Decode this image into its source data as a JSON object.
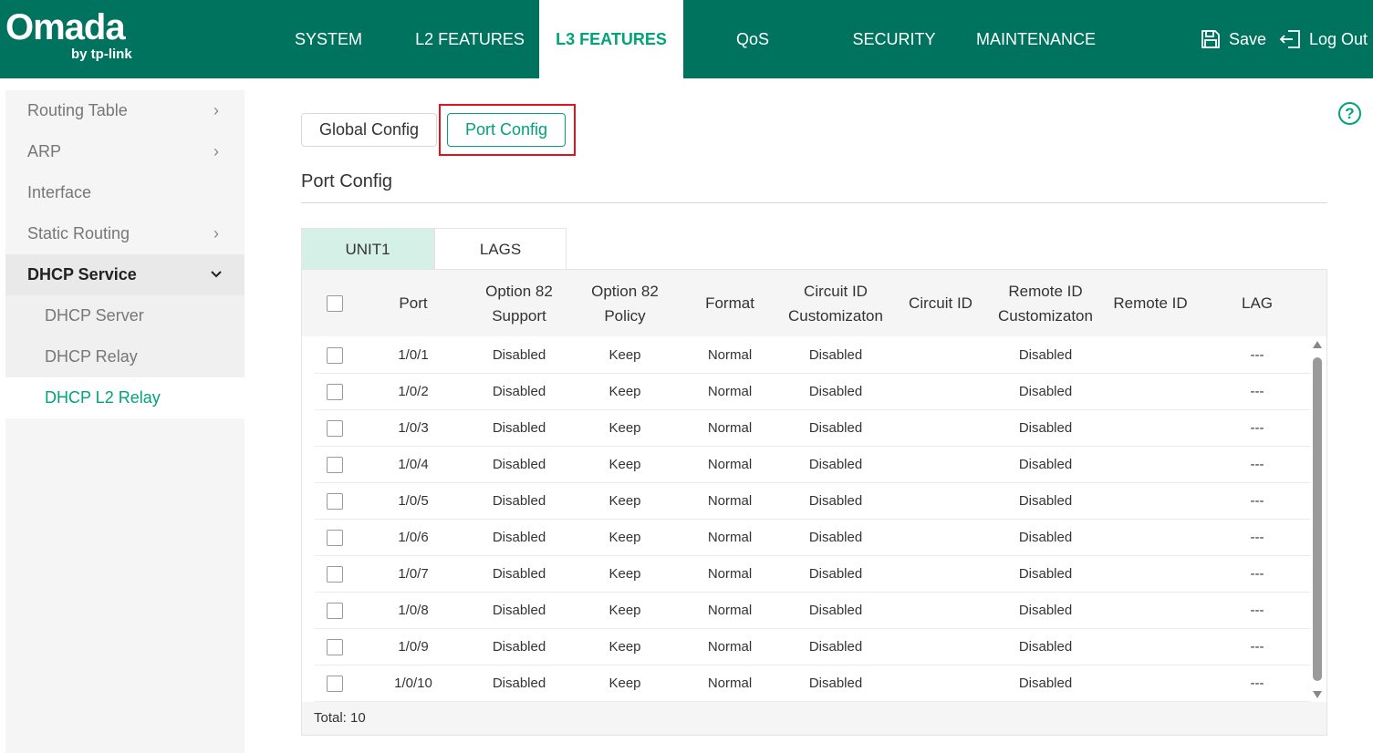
{
  "brand": {
    "name": "Omada",
    "sub": "by tp-link"
  },
  "nav": {
    "items": [
      {
        "label": "SYSTEM"
      },
      {
        "label": "L2 FEATURES"
      },
      {
        "label": "L3 FEATURES"
      },
      {
        "label": "QoS"
      },
      {
        "label": "SECURITY"
      },
      {
        "label": "MAINTENANCE"
      }
    ],
    "active": "L3 FEATURES"
  },
  "actions": {
    "save": "Save",
    "logout": "Log Out"
  },
  "sidebar": {
    "items": [
      {
        "label": "Routing Table",
        "chevron": ">"
      },
      {
        "label": "ARP",
        "chevron": ">"
      },
      {
        "label": "Interface"
      },
      {
        "label": "Static Routing",
        "chevron": ">"
      },
      {
        "label": "DHCP Service",
        "chevron": "v"
      },
      {
        "label": "DHCP Server"
      },
      {
        "label": "DHCP Relay"
      },
      {
        "label": "DHCP L2 Relay"
      }
    ]
  },
  "help": "?",
  "tabs": {
    "global": "Global Config",
    "port": "Port Config"
  },
  "section_title": "Port Config",
  "unit_tabs": {
    "unit1": "UNIT1",
    "lags": "LAGS"
  },
  "table": {
    "headers": {
      "port": "Port",
      "opt82_support_1": "Option 82",
      "opt82_support_2": "Support",
      "opt82_policy_1": "Option 82",
      "opt82_policy_2": "Policy",
      "format": "Format",
      "cid_custom_1": "Circuit ID",
      "cid_custom_2": "Customizaton",
      "cid": "Circuit ID",
      "rid_custom_1": "Remote ID",
      "rid_custom_2": "Customizaton",
      "rid": "Remote ID",
      "lag": "LAG"
    },
    "rows": [
      {
        "port": "1/0/1",
        "support": "Disabled",
        "policy": "Keep",
        "format": "Normal",
        "cid_custom": "Disabled",
        "cid": "",
        "rid_custom": "Disabled",
        "rid": "",
        "lag": "---"
      },
      {
        "port": "1/0/2",
        "support": "Disabled",
        "policy": "Keep",
        "format": "Normal",
        "cid_custom": "Disabled",
        "cid": "",
        "rid_custom": "Disabled",
        "rid": "",
        "lag": "---"
      },
      {
        "port": "1/0/3",
        "support": "Disabled",
        "policy": "Keep",
        "format": "Normal",
        "cid_custom": "Disabled",
        "cid": "",
        "rid_custom": "Disabled",
        "rid": "",
        "lag": "---"
      },
      {
        "port": "1/0/4",
        "support": "Disabled",
        "policy": "Keep",
        "format": "Normal",
        "cid_custom": "Disabled",
        "cid": "",
        "rid_custom": "Disabled",
        "rid": "",
        "lag": "---"
      },
      {
        "port": "1/0/5",
        "support": "Disabled",
        "policy": "Keep",
        "format": "Normal",
        "cid_custom": "Disabled",
        "cid": "",
        "rid_custom": "Disabled",
        "rid": "",
        "lag": "---"
      },
      {
        "port": "1/0/6",
        "support": "Disabled",
        "policy": "Keep",
        "format": "Normal",
        "cid_custom": "Disabled",
        "cid": "",
        "rid_custom": "Disabled",
        "rid": "",
        "lag": "---"
      },
      {
        "port": "1/0/7",
        "support": "Disabled",
        "policy": "Keep",
        "format": "Normal",
        "cid_custom": "Disabled",
        "cid": "",
        "rid_custom": "Disabled",
        "rid": "",
        "lag": "---"
      },
      {
        "port": "1/0/8",
        "support": "Disabled",
        "policy": "Keep",
        "format": "Normal",
        "cid_custom": "Disabled",
        "cid": "",
        "rid_custom": "Disabled",
        "rid": "",
        "lag": "---"
      },
      {
        "port": "1/0/9",
        "support": "Disabled",
        "policy": "Keep",
        "format": "Normal",
        "cid_custom": "Disabled",
        "cid": "",
        "rid_custom": "Disabled",
        "rid": "",
        "lag": "---"
      },
      {
        "port": "1/0/10",
        "support": "Disabled",
        "policy": "Keep",
        "format": "Normal",
        "cid_custom": "Disabled",
        "cid": "",
        "rid_custom": "Disabled",
        "rid": "",
        "lag": "---"
      }
    ],
    "total": "Total: 10"
  },
  "colors": {
    "brand": "#00735f",
    "accent": "#00a37a",
    "highlight": "#e0141e"
  }
}
